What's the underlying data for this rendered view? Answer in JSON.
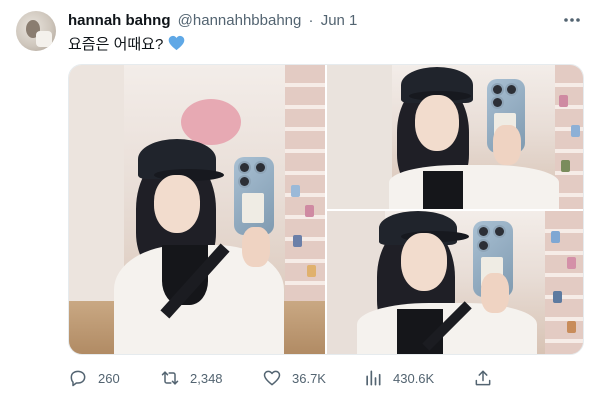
{
  "author": {
    "display_name": "hannah bahng",
    "handle": "@hannahhbbahng",
    "separator": "·",
    "date": "Jun 1"
  },
  "tweet": {
    "text": "요즘은 어때요?"
  },
  "media": {
    "photo_count": 3
  },
  "actions": {
    "replies": "260",
    "retweets": "2,348",
    "likes": "36.7K",
    "views": "430.6K"
  },
  "colors": {
    "text_primary": "#0f1419",
    "text_secondary": "#536471",
    "heart_emoji": "#5fa8e6",
    "border": "#e6ebee"
  },
  "icons": {
    "more": "more-horizontal-icon",
    "heart": "blue-heart-emoji-icon",
    "reply": "reply-bubble-icon",
    "retweet": "retweet-arrows-icon",
    "like": "heart-outline-icon",
    "views": "analytics-bars-icon",
    "share": "share-upload-icon"
  }
}
